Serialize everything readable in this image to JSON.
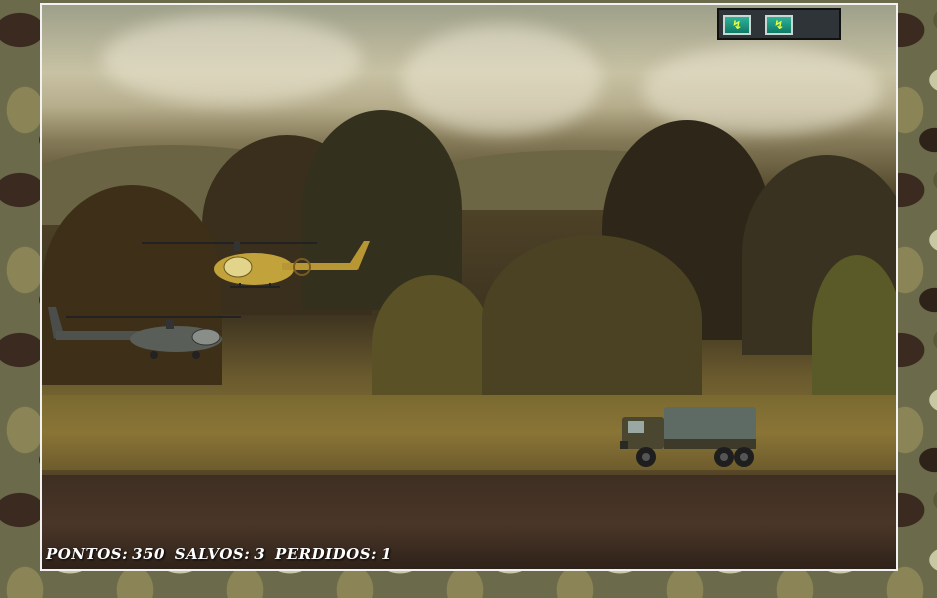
{
  "hud": {
    "score_label": "PONTOS:",
    "score_value": "350",
    "saved_label": "SALVOS:",
    "saved_value": "3",
    "lost_label": "PERDIDOS:",
    "lost_value": "1",
    "energy_cells": 2,
    "energy_icon": "lightning-bolt",
    "energy_glyph": "↯"
  },
  "sprites": {
    "player": "yellow-helicopter",
    "enemy": "gray-attack-helicopter",
    "friend": "military-truck"
  },
  "colors": {
    "energy_cell": "#1e9c85",
    "bolt": "#e8ff3a",
    "frame_border": "#f2f2f2"
  }
}
